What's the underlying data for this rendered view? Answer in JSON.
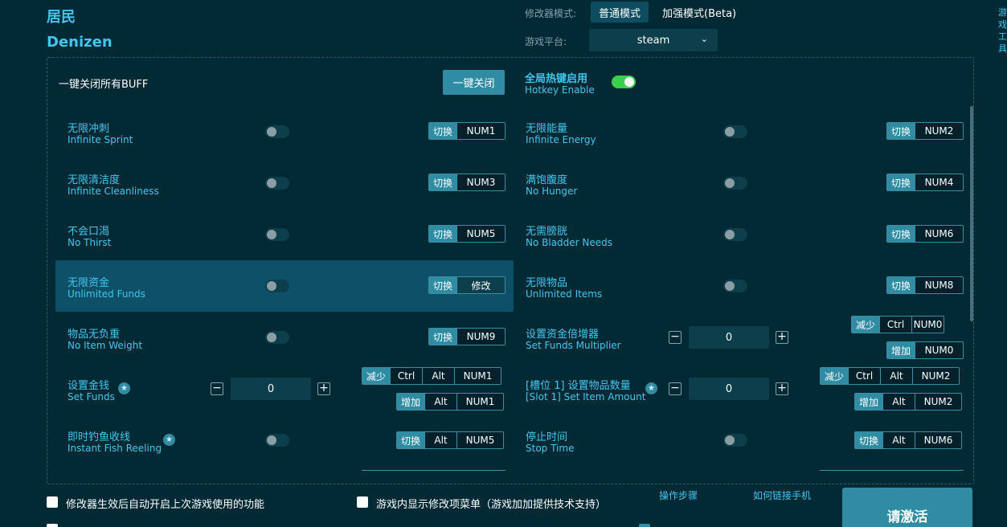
{
  "header": {
    "title_cn": "居民",
    "title_en": "Denizen",
    "mode_label": "修改器模式:",
    "mode_normal": "普通模式",
    "mode_enhanced": "加强模式(Beta)",
    "platform_label": "游戏平台:",
    "platform_value": "steam",
    "side_tool": "游戏工具"
  },
  "global": {
    "close_all_label": "一键关闭所有BUFF",
    "close_all_button": "一键关闭",
    "hotkey_cn": "全局热键启用",
    "hotkey_en": "Hotkey Enable",
    "hotkey_enabled": true
  },
  "cheats": [
    {
      "cn": "无限冲刺",
      "en": "Infinite Sprint",
      "tag": "切换",
      "keys": [
        "NUM1"
      ]
    },
    {
      "cn": "无限能量",
      "en": "Infinite Energy",
      "tag": "切换",
      "keys": [
        "NUM2"
      ]
    },
    {
      "cn": "无限清洁度",
      "en": "Infinite Cleanliness",
      "tag": "切换",
      "keys": [
        "NUM3"
      ]
    },
    {
      "cn": "满饱腹度",
      "en": "No Hunger",
      "tag": "切换",
      "keys": [
        "NUM4"
      ]
    },
    {
      "cn": "不会口渴",
      "en": "No Thirst",
      "tag": "切换",
      "keys": [
        "NUM5"
      ]
    },
    {
      "cn": "无需膀胱",
      "en": "No Bladder Needs",
      "tag": "切换",
      "keys": [
        "NUM6"
      ]
    },
    {
      "cn": "无限资金",
      "en": "Unlimited Funds",
      "tag": "切换",
      "keys": [
        "修改"
      ]
    },
    {
      "cn": "无限物品",
      "en": "Unlimited Items",
      "tag": "切换",
      "keys": [
        "NUM8"
      ]
    },
    {
      "cn": "物品无负重",
      "en": "No Item Weight",
      "tag": "切换",
      "keys": [
        "NUM9"
      ]
    },
    {
      "cn": "设置资金倍增器",
      "en": "Set Funds Multiplier",
      "value": "0",
      "dec": {
        "tag": "减少",
        "keys": [
          "Ctrl",
          "NUM0"
        ]
      },
      "inc": {
        "tag": "增加",
        "keys": [
          "NUM0"
        ]
      }
    },
    {
      "cn": "设置金钱",
      "en": "Set Funds",
      "value": "0",
      "dec": {
        "tag": "减少",
        "keys": [
          "Ctrl",
          "Alt",
          "NUM1"
        ]
      },
      "inc": {
        "tag": "增加",
        "keys": [
          "Alt",
          "NUM1"
        ]
      }
    },
    {
      "cn": "[槽位 1] 设置物品数量",
      "en": "[Slot 1] Set Item Amount",
      "value": "0",
      "dec": {
        "tag": "减少",
        "keys": [
          "Ctrl",
          "Alt",
          "NUM2"
        ]
      },
      "inc": {
        "tag": "增加",
        "keys": [
          "Alt",
          "NUM2"
        ]
      }
    },
    {
      "cn": "即时钓鱼收线",
      "en": "Instant Fish Reeling",
      "tag": "切换",
      "keys": [
        "Alt",
        "NUM5"
      ]
    },
    {
      "cn": "停止时间",
      "en": "Stop Time",
      "tag": "切换",
      "keys": [
        "Alt",
        "NUM6"
      ]
    }
  ],
  "footer": {
    "auto_enable": "修改器生效后自动开启上次游戏使用的功能",
    "ingame_menu": "游戏内显示修改项菜单（游戏加加提供技术支持）",
    "steps_link": "操作步骤",
    "phone_link": "如何链接手机",
    "activate": "请激活"
  }
}
